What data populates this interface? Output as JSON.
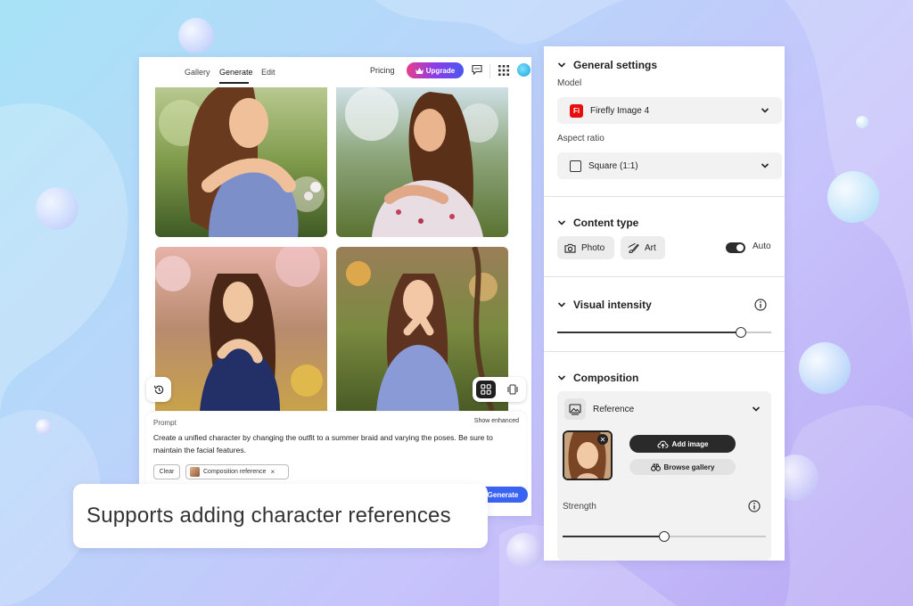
{
  "nav": {
    "tabs": [
      {
        "label": "Gallery",
        "active": false
      },
      {
        "label": "Generate",
        "active": true
      },
      {
        "label": "Edit",
        "active": false
      }
    ],
    "pricing": "Pricing",
    "upgrade": "Upgrade",
    "icons": [
      "comment-icon",
      "apps-grid-icon",
      "user-avatar"
    ]
  },
  "gallery": {
    "images": [
      "generated-image-1",
      "generated-image-2",
      "generated-image-3",
      "generated-image-4"
    ]
  },
  "prompt": {
    "label": "Prompt",
    "show_enhanced": "Show enhanced",
    "text": "Create a unified character by changing the outfit to a summer braid and varying the poses. Be sure to maintain the facial features.",
    "clear": "Clear",
    "chip": "Composition reference",
    "chip_close": "×",
    "generate": "Generate"
  },
  "caption": "Supports adding character references",
  "settings": {
    "general": {
      "title": "General settings",
      "model_label": "Model",
      "model_value": "Firefly Image 4",
      "model_logo": "Fi",
      "aspect_label": "Aspect ratio",
      "aspect_value": "Square (1:1)"
    },
    "content_type": {
      "title": "Content type",
      "photo": "Photo",
      "art": "Art",
      "auto": "Auto",
      "auto_on": true
    },
    "visual_intensity": {
      "title": "Visual intensity",
      "level": 0.86
    },
    "composition": {
      "title": "Composition",
      "reference": "Reference",
      "add_image": "Add image",
      "browse_gallery": "Browse gallery",
      "strength_label": "Strength",
      "strength": 0.5
    }
  },
  "colors": {
    "accent": "#3b63f2",
    "upgrade_gradient": [
      "#e83e8c",
      "#8b3ce8",
      "#4b57f0"
    ],
    "firefly_red": "#e60e0e"
  }
}
